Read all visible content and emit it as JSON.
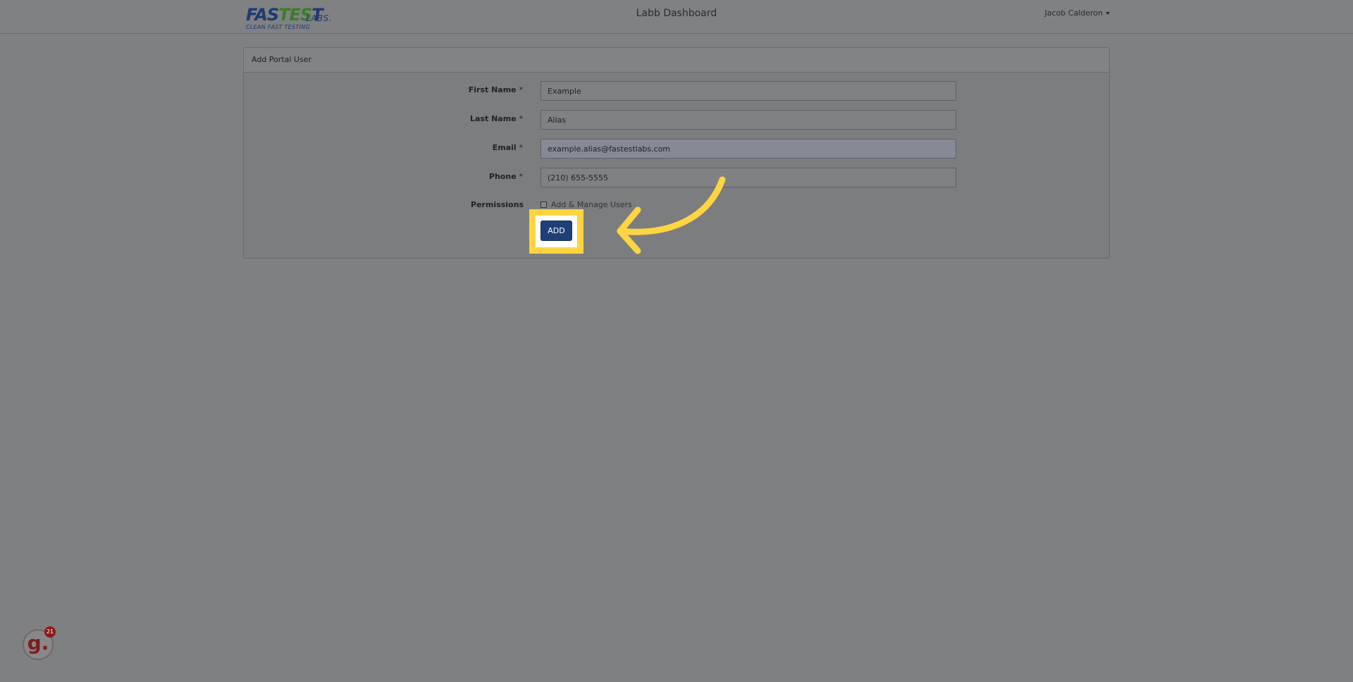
{
  "logo": {
    "part1": "FAS",
    "part2": "TES",
    "part3": "T",
    "labs": "LABS.",
    "tagline": "CLEAN FAST TESTING"
  },
  "navbar": {
    "title": "Labb Dashboard",
    "user": "Jacob Calderon"
  },
  "panel": {
    "heading": "Add Portal User"
  },
  "form": {
    "required_mark": "*",
    "first_name": {
      "label": "First Name",
      "value": "Example"
    },
    "last_name": {
      "label": "Last Name",
      "value": "Alias"
    },
    "email": {
      "label": "Email",
      "value": "example.alias@fastestlabs.com"
    },
    "phone": {
      "label": "Phone",
      "value": "(210) 655-5555"
    },
    "permissions": {
      "label": "Permissions",
      "option": "Add & Manage Users",
      "checked": false
    },
    "submit_label": "ADD"
  },
  "annotation": {
    "highlight_color": "#fcd541",
    "arrow_color": "#fcd541"
  },
  "badge": {
    "letter": "g.",
    "count": "21"
  },
  "colors": {
    "overlay": "#7f8081",
    "button": "#1f3f76"
  }
}
